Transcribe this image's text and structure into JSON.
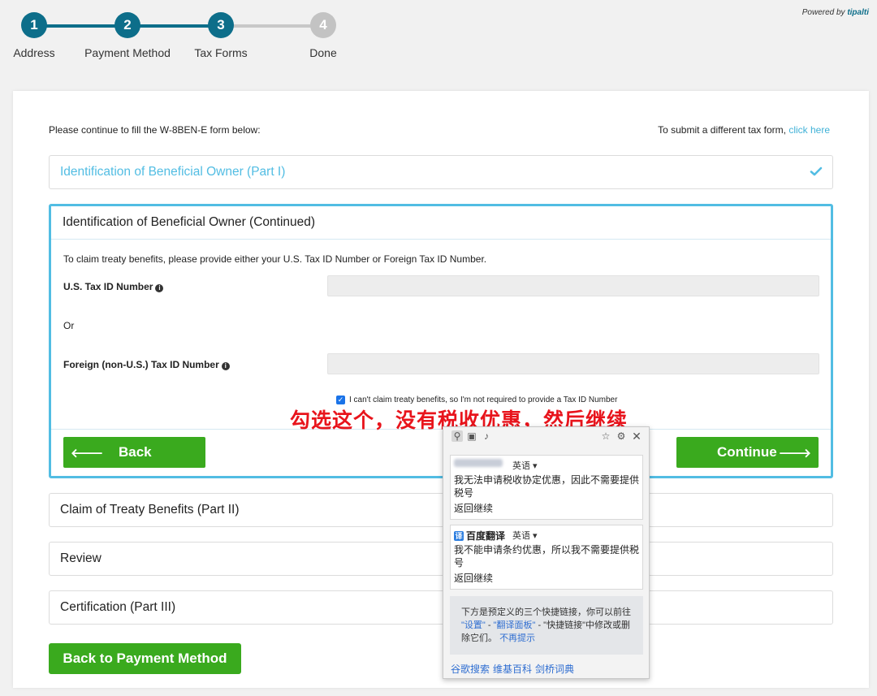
{
  "steps": [
    {
      "number": "1",
      "label": "Address",
      "state": "done"
    },
    {
      "number": "2",
      "label": "Payment Method",
      "state": "done"
    },
    {
      "number": "3",
      "label": "Tax Forms",
      "state": "done"
    },
    {
      "number": "4",
      "label": "Done",
      "state": "todo"
    }
  ],
  "powered_by": {
    "prefix": "Powered by",
    "brand": "tipalti"
  },
  "intro": "Please continue to fill the W-8BEN-E form below:",
  "submit_different": {
    "text": "To submit a different tax form,",
    "link": "click here"
  },
  "panel_part1": {
    "title": "Identification of Beneficial Owner (Part I)"
  },
  "panel_continued": {
    "title": "Identification of Beneficial Owner (Continued)",
    "claim_text": "To claim treaty benefits, please provide either your U.S. Tax ID Number or Foreign Tax ID Number.",
    "us_tax_label": "U.S. Tax ID Number",
    "or_label": "Or",
    "foreign_tax_label": "Foreign (non-U.S.) Tax ID Number",
    "checkbox_label": "I can't claim treaty benefits, so I'm not required to provide a Tax ID Number",
    "back_label": "Back",
    "continue_label": "Continue"
  },
  "panel_part2": {
    "title": "Claim of Treaty Benefits (Part II)"
  },
  "panel_review": {
    "title": "Review"
  },
  "panel_part3": {
    "title": "Certification (Part III)"
  },
  "back_to_payment": "Back to Payment Method",
  "annotation": "勾选这个，没有税收优惠，然后继续",
  "translate_popup": {
    "google": {
      "lang": "英语 ▾",
      "text": "我无法申请税收协定优惠，因此不需要提供税号",
      "back": "返回继续"
    },
    "baidu": {
      "name": "百度翻译",
      "badge": "译",
      "lang": "英语 ▾",
      "text": "我不能申请条约优惠，所以我不需要提供税号",
      "back": "返回继续"
    },
    "quick": {
      "line1": "下方是预定义的三个快捷链接，你可以前往",
      "settings": "\"设置\"",
      "sep1": " - ",
      "panel": "\"翻译面板\"",
      "sep2": " - \"快捷链接\"中修改或删除它们。",
      "dismiss": "不再提示"
    },
    "links": [
      "谷歌搜索",
      "维基百科",
      "剑桥词典"
    ]
  },
  "colors": {
    "primary": "#0d6e8a",
    "accent": "#52bde3",
    "button_green": "#3aaa1e",
    "annotation_red": "#e8141c"
  }
}
